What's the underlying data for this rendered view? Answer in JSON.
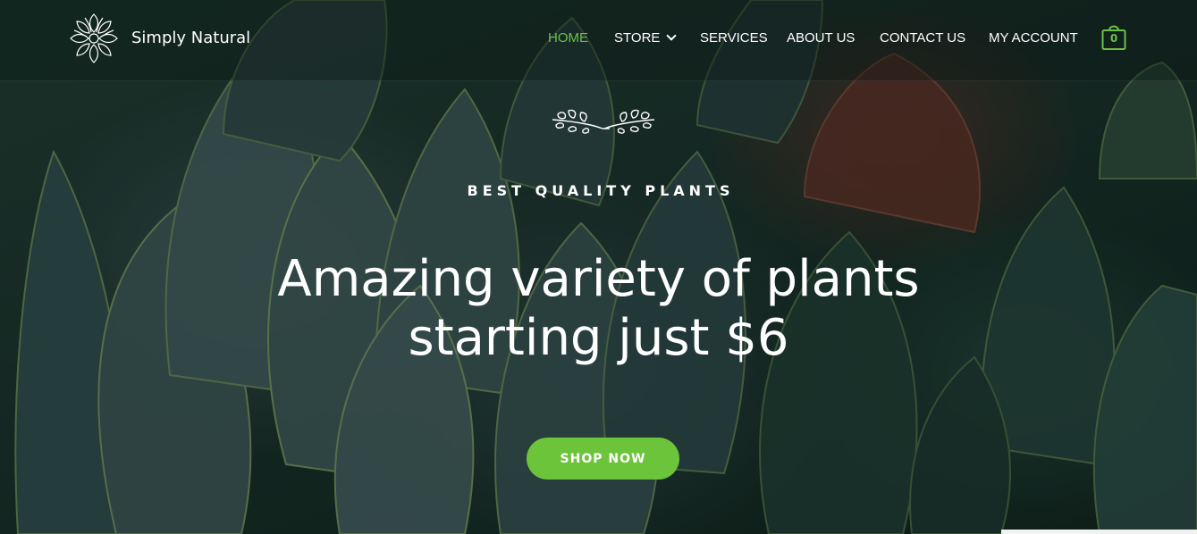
{
  "brand": {
    "name": "Simply Natural",
    "logo_icon": "succulent-logo-icon"
  },
  "nav": {
    "items": [
      {
        "label": "HOME",
        "active": true
      },
      {
        "label": "STORE",
        "has_dropdown": true
      },
      {
        "label": "SERVICES"
      },
      {
        "label": "ABOUT US"
      },
      {
        "label": "CONTACT US"
      },
      {
        "label": "MY ACCOUNT"
      }
    ],
    "cart_count": "0",
    "cart_icon": "shopping-bag-icon"
  },
  "hero": {
    "ornament_icon": "laurel-leaves-icon",
    "eyebrow": "BEST QUALITY PLANTS",
    "headline_line1": "Amazing variety of plants",
    "headline_line2": "starting just $6",
    "cta_label": "SHOP NOW"
  },
  "colors": {
    "accent": "#6cc04a",
    "button": "#6cc43a",
    "text": "#ffffff"
  }
}
